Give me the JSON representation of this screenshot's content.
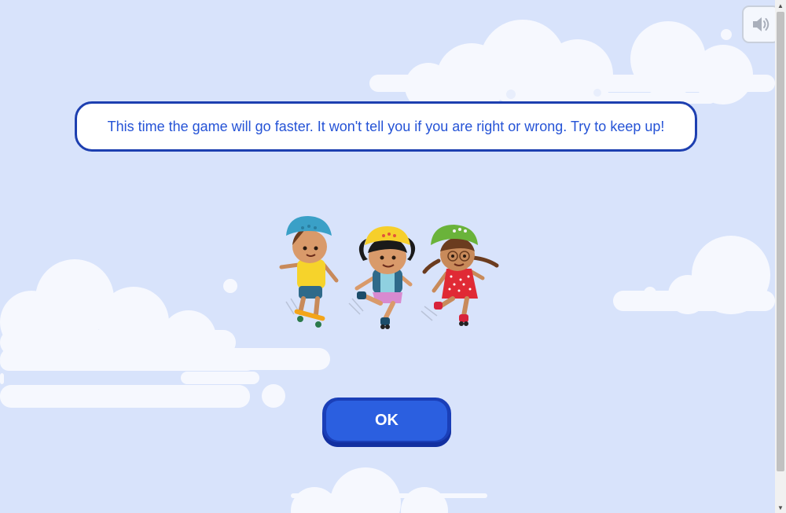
{
  "game": {
    "message": "This time the game will go faster. It won't tell you if you are right or wrong. Try to keep up!",
    "ok_label": "OK"
  },
  "sound_button": {
    "icon": "speaker-icon"
  },
  "illustration": {
    "characters": [
      "skateboard-boy",
      "rollerskate-girl-yellow-helmet",
      "rollerskate-girl-green-helmet"
    ]
  },
  "scrollbar": {
    "up_glyph": "▲",
    "down_glyph": "▼"
  },
  "colors": {
    "background": "#d8e3fb",
    "cloud": "#f6f8fe",
    "accent_blue": "#2553d6",
    "button_dark": "#1a3fb8"
  }
}
